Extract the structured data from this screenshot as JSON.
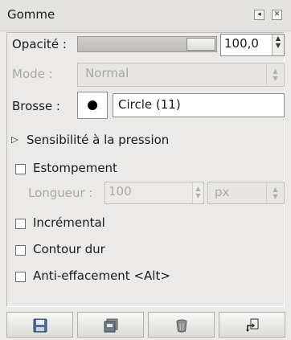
{
  "window": {
    "title": "Gomme"
  },
  "opacity": {
    "label": "Opacité :",
    "value": "100,0",
    "percent": 100
  },
  "mode": {
    "label": "Mode :",
    "value": "Normal"
  },
  "brush": {
    "label": "Brosse :",
    "name": "Circle (11)"
  },
  "pressure": {
    "label": "Sensibilité à la pression",
    "expanded": false
  },
  "fade": {
    "label": "Estompement",
    "checked": false,
    "length_label": "Longueur :",
    "length_value": "100",
    "unit": "px"
  },
  "options": {
    "incremental": {
      "label": "Incrémental",
      "checked": false
    },
    "hard_edge": {
      "label": "Contour dur",
      "checked": false
    },
    "anti_erase": {
      "label": "Anti-effacement <Alt>",
      "checked": false
    }
  },
  "icons": {
    "tab_menu": "tab-menu-icon",
    "close": "close-icon",
    "save": "save-icon",
    "restore": "restore-icon",
    "delete": "delete-icon",
    "reset": "reset-icon"
  }
}
